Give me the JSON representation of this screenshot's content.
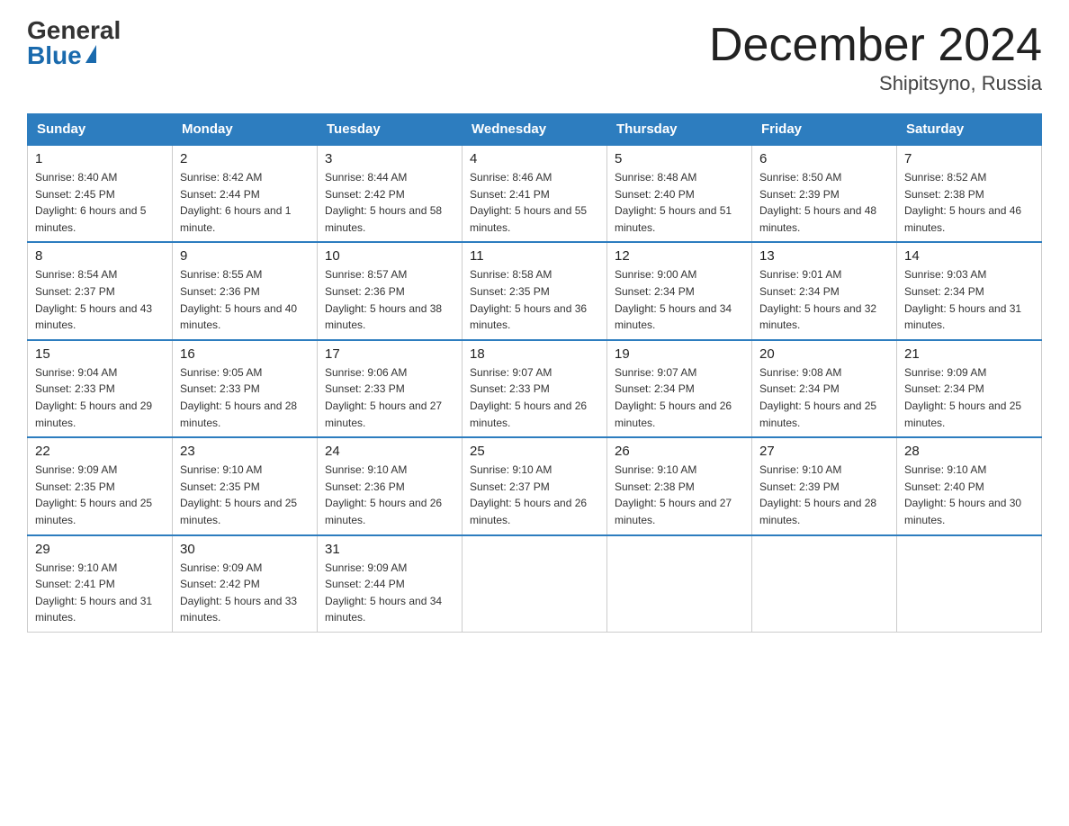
{
  "header": {
    "logo_general": "General",
    "logo_blue": "Blue",
    "month_title": "December 2024",
    "location": "Shipitsyno, Russia"
  },
  "weekdays": [
    "Sunday",
    "Monday",
    "Tuesday",
    "Wednesday",
    "Thursday",
    "Friday",
    "Saturday"
  ],
  "weeks": [
    [
      {
        "day": "1",
        "sunrise": "8:40 AM",
        "sunset": "2:45 PM",
        "daylight": "6 hours and 5 minutes."
      },
      {
        "day": "2",
        "sunrise": "8:42 AM",
        "sunset": "2:44 PM",
        "daylight": "6 hours and 1 minute."
      },
      {
        "day": "3",
        "sunrise": "8:44 AM",
        "sunset": "2:42 PM",
        "daylight": "5 hours and 58 minutes."
      },
      {
        "day": "4",
        "sunrise": "8:46 AM",
        "sunset": "2:41 PM",
        "daylight": "5 hours and 55 minutes."
      },
      {
        "day": "5",
        "sunrise": "8:48 AM",
        "sunset": "2:40 PM",
        "daylight": "5 hours and 51 minutes."
      },
      {
        "day": "6",
        "sunrise": "8:50 AM",
        "sunset": "2:39 PM",
        "daylight": "5 hours and 48 minutes."
      },
      {
        "day": "7",
        "sunrise": "8:52 AM",
        "sunset": "2:38 PM",
        "daylight": "5 hours and 46 minutes."
      }
    ],
    [
      {
        "day": "8",
        "sunrise": "8:54 AM",
        "sunset": "2:37 PM",
        "daylight": "5 hours and 43 minutes."
      },
      {
        "day": "9",
        "sunrise": "8:55 AM",
        "sunset": "2:36 PM",
        "daylight": "5 hours and 40 minutes."
      },
      {
        "day": "10",
        "sunrise": "8:57 AM",
        "sunset": "2:36 PM",
        "daylight": "5 hours and 38 minutes."
      },
      {
        "day": "11",
        "sunrise": "8:58 AM",
        "sunset": "2:35 PM",
        "daylight": "5 hours and 36 minutes."
      },
      {
        "day": "12",
        "sunrise": "9:00 AM",
        "sunset": "2:34 PM",
        "daylight": "5 hours and 34 minutes."
      },
      {
        "day": "13",
        "sunrise": "9:01 AM",
        "sunset": "2:34 PM",
        "daylight": "5 hours and 32 minutes."
      },
      {
        "day": "14",
        "sunrise": "9:03 AM",
        "sunset": "2:34 PM",
        "daylight": "5 hours and 31 minutes."
      }
    ],
    [
      {
        "day": "15",
        "sunrise": "9:04 AM",
        "sunset": "2:33 PM",
        "daylight": "5 hours and 29 minutes."
      },
      {
        "day": "16",
        "sunrise": "9:05 AM",
        "sunset": "2:33 PM",
        "daylight": "5 hours and 28 minutes."
      },
      {
        "day": "17",
        "sunrise": "9:06 AM",
        "sunset": "2:33 PM",
        "daylight": "5 hours and 27 minutes."
      },
      {
        "day": "18",
        "sunrise": "9:07 AM",
        "sunset": "2:33 PM",
        "daylight": "5 hours and 26 minutes."
      },
      {
        "day": "19",
        "sunrise": "9:07 AM",
        "sunset": "2:34 PM",
        "daylight": "5 hours and 26 minutes."
      },
      {
        "day": "20",
        "sunrise": "9:08 AM",
        "sunset": "2:34 PM",
        "daylight": "5 hours and 25 minutes."
      },
      {
        "day": "21",
        "sunrise": "9:09 AM",
        "sunset": "2:34 PM",
        "daylight": "5 hours and 25 minutes."
      }
    ],
    [
      {
        "day": "22",
        "sunrise": "9:09 AM",
        "sunset": "2:35 PM",
        "daylight": "5 hours and 25 minutes."
      },
      {
        "day": "23",
        "sunrise": "9:10 AM",
        "sunset": "2:35 PM",
        "daylight": "5 hours and 25 minutes."
      },
      {
        "day": "24",
        "sunrise": "9:10 AM",
        "sunset": "2:36 PM",
        "daylight": "5 hours and 26 minutes."
      },
      {
        "day": "25",
        "sunrise": "9:10 AM",
        "sunset": "2:37 PM",
        "daylight": "5 hours and 26 minutes."
      },
      {
        "day": "26",
        "sunrise": "9:10 AM",
        "sunset": "2:38 PM",
        "daylight": "5 hours and 27 minutes."
      },
      {
        "day": "27",
        "sunrise": "9:10 AM",
        "sunset": "2:39 PM",
        "daylight": "5 hours and 28 minutes."
      },
      {
        "day": "28",
        "sunrise": "9:10 AM",
        "sunset": "2:40 PM",
        "daylight": "5 hours and 30 minutes."
      }
    ],
    [
      {
        "day": "29",
        "sunrise": "9:10 AM",
        "sunset": "2:41 PM",
        "daylight": "5 hours and 31 minutes."
      },
      {
        "day": "30",
        "sunrise": "9:09 AM",
        "sunset": "2:42 PM",
        "daylight": "5 hours and 33 minutes."
      },
      {
        "day": "31",
        "sunrise": "9:09 AM",
        "sunset": "2:44 PM",
        "daylight": "5 hours and 34 minutes."
      },
      null,
      null,
      null,
      null
    ]
  ]
}
